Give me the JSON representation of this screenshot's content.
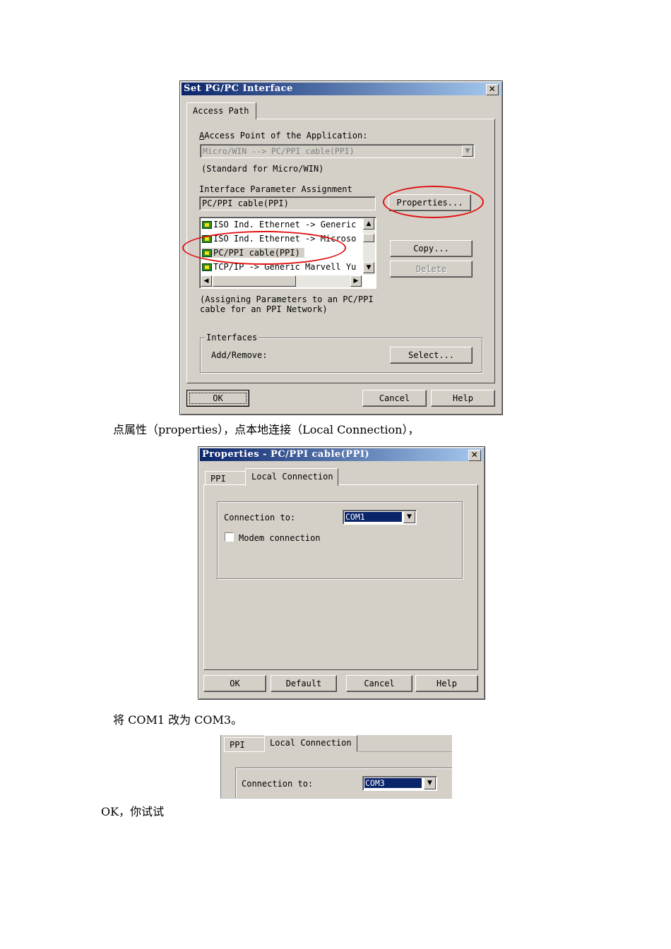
{
  "dialog1": {
    "title": "Set PG/PC Interface",
    "tab": "Access Path",
    "access_point_label": "Access Point of the Application:",
    "access_point_value": "Micro/WIN        --> PC/PPI cable(PPI)",
    "access_point_note": "(Standard for Micro/WIN)",
    "param_label": "Interface Parameter Assignment",
    "param_value": "PC/PPI cable(PPI)",
    "list_items": [
      "ISO Ind. Ethernet -> Generic",
      "ISO Ind. Ethernet -> Microso",
      "PC/PPI cable(PPI)",
      "TCP/IP -> Generic Marvell Yu"
    ],
    "description": "(Assigning Parameters to an PC/PPI\ncable for an PPI Network)",
    "interfaces_group": "Interfaces",
    "add_remove_label": "Add/Remove:",
    "buttons": {
      "properties": "Properties...",
      "copy": "Copy...",
      "delete": "Delete",
      "select": "Select...",
      "ok": "OK",
      "cancel": "Cancel",
      "help": "Help"
    }
  },
  "caption1": "点属性（properties），点本地连接（Local Connection），",
  "dialog2": {
    "title": "Properties - PC/PPI cable(PPI)",
    "tabs": [
      "PPI",
      "Local Connection"
    ],
    "connection_label": "Connection to:",
    "connection_value": "COM1",
    "modem_label": "Modem connection",
    "buttons": {
      "ok": "OK",
      "default": "Default",
      "cancel": "Cancel",
      "help": "Help"
    }
  },
  "caption2": "将 COM1 改为 COM3。",
  "dialog3": {
    "tabs": [
      "PPI",
      "Local Connection"
    ],
    "connection_label": "Connection to:",
    "connection_value": "COM3"
  },
  "caption3": "OK，你试试",
  "colors": {
    "dialog_bg": "#d4d0c8",
    "titlebar": "#0a246a",
    "highlight": "#0a246a",
    "annotation": "#e01010"
  }
}
